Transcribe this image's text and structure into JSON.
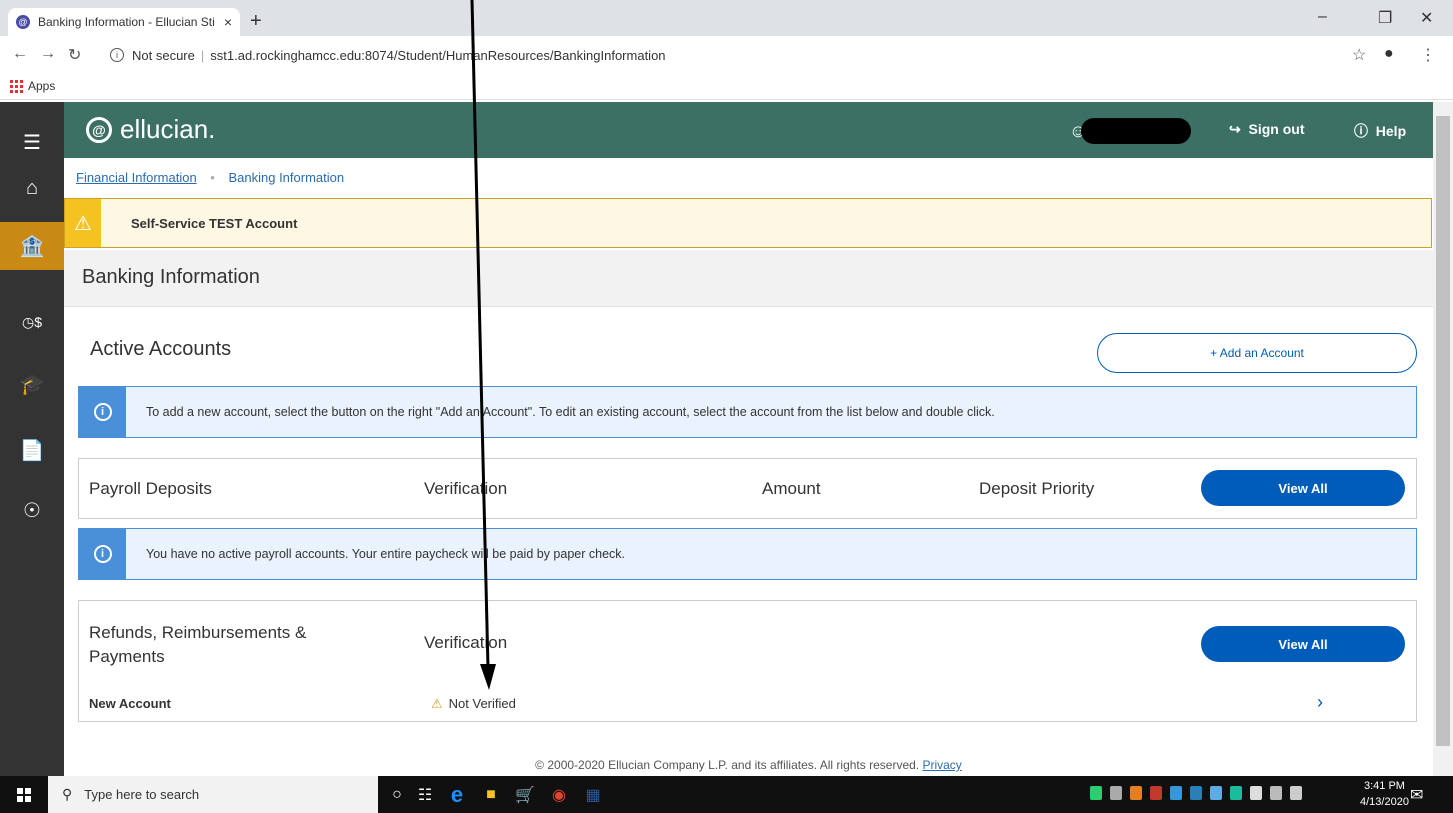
{
  "browser": {
    "tab_title": "Banking Information - Ellucian Sti",
    "tab_close": "×",
    "new_tab": "+",
    "security_label": "Not secure",
    "url": "sst1.ad.rockinghamcc.edu:8074/Student/HumanResources/BankingInformation",
    "bookmarks_apps": "Apps"
  },
  "header": {
    "logo_text": "ellucian.",
    "sign_out": "Sign out",
    "help": "Help"
  },
  "breadcrumb": {
    "parent": "Financial Information",
    "current": "Banking Information"
  },
  "banner": {
    "text": "Self-Service TEST Account"
  },
  "page": {
    "title": "Banking Information",
    "active_accounts_title": "Active Accounts",
    "add_account_label": "+ Add an Account",
    "info_add_account": "To add a new account, select the button on the right \"Add an Account\". To edit an existing account, select the account from the list below and double click."
  },
  "payroll": {
    "title": "Payroll Deposits",
    "col_verification": "Verification",
    "col_amount": "Amount",
    "col_priority": "Deposit Priority",
    "view_all": "View All",
    "info_no_accounts": "You have no active payroll accounts. Your entire paycheck will be paid by paper check."
  },
  "refunds": {
    "title": "Refunds, Reimbursements &",
    "title_line2": "Payments",
    "col_verification": "Verification",
    "view_all": "View All",
    "rows": [
      {
        "name": "New Account",
        "status": "Not Verified"
      }
    ]
  },
  "footer": {
    "copyright": "© 2000-2020 Ellucian Company L.P. and its affiliates. All rights reserved.",
    "privacy": "Privacy"
  },
  "taskbar": {
    "search_placeholder": "Type here to search",
    "time": "3:41 PM",
    "date": "4/13/2020"
  },
  "colors": {
    "header_green": "#3c7065",
    "nav_active": "#c88a14",
    "primary_blue": "#005cb9",
    "info_blue": "#4a90d9",
    "warning_yellow": "#f4c322"
  }
}
